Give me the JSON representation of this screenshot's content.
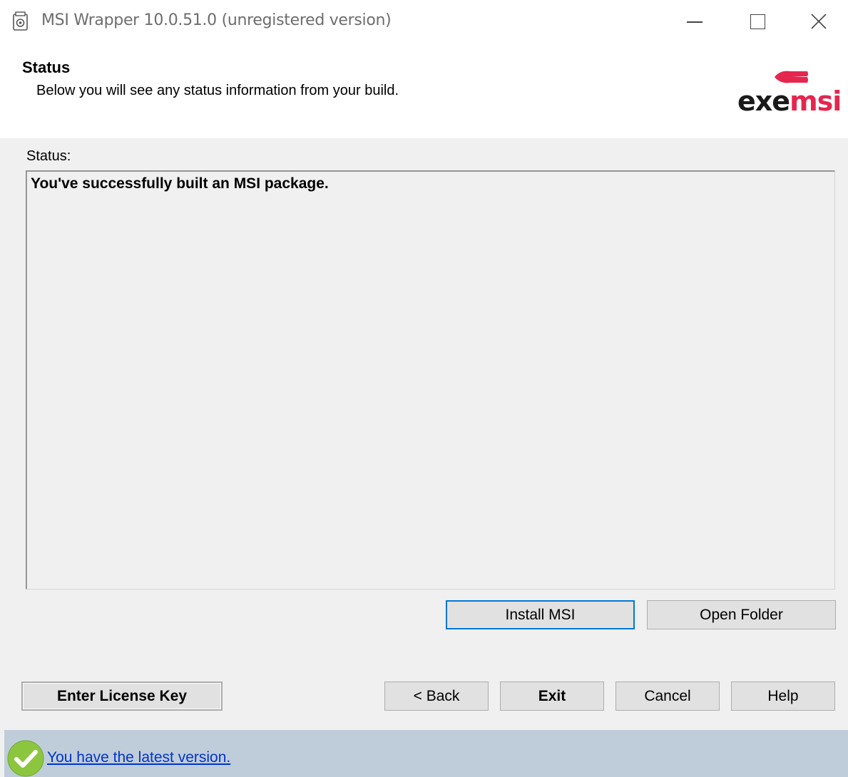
{
  "window": {
    "title": "MSI Wrapper 10.0.51.0 (unregistered version)"
  },
  "header": {
    "title": "Status",
    "subtitle": "Below you will see any status information from your build.",
    "logo": {
      "part1": "exe",
      "part2": "msi",
      "accent_color": "#e5264f"
    }
  },
  "status": {
    "label": "Status:",
    "message": "You've successfully built an MSI package."
  },
  "actions": {
    "install_msi": "Install MSI",
    "open_folder": "Open Folder"
  },
  "footer_buttons": {
    "license": "Enter License Key",
    "back": "< Back",
    "exit": "Exit",
    "cancel": "Cancel",
    "help": "Help"
  },
  "update": {
    "link_text": "You have the latest version.",
    "icon": "check-icon"
  }
}
